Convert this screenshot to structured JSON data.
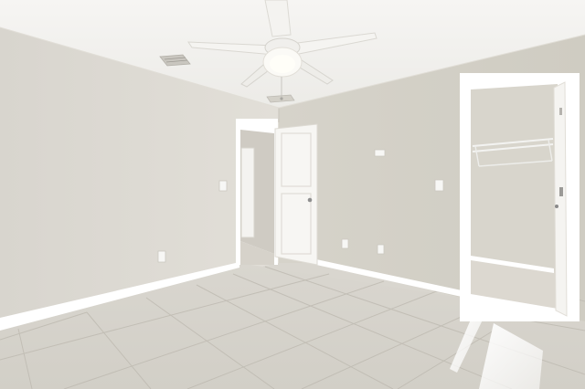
{
  "scene": {
    "type": "photo",
    "colors": {
      "ceiling": "#f2f1ee",
      "wall_left": "#dcd9d1",
      "wall_back": "#d3d0c7",
      "floor": "#d8d5cd",
      "trim": "#ffffff",
      "closet_wall": "#d7d4cc"
    },
    "icons": [
      "ceiling-fan-icon",
      "air-vent-icon",
      "door-icon",
      "closet-icon",
      "electrical-outlet-icon",
      "light-switch-icon"
    ]
  }
}
